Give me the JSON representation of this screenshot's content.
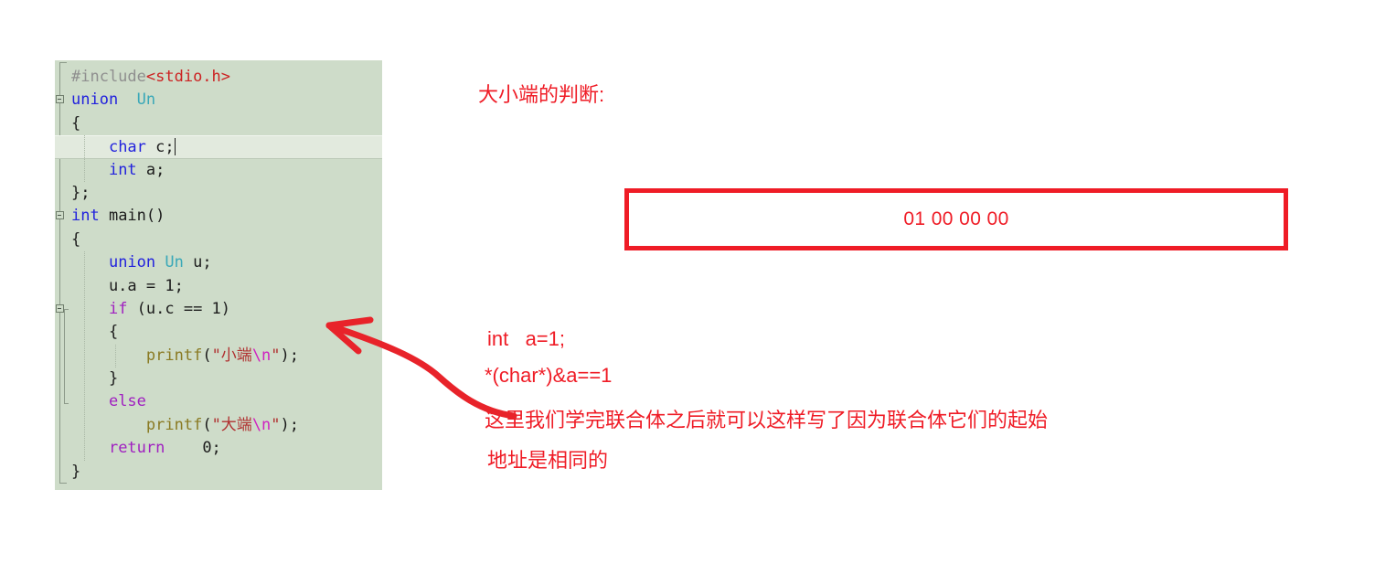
{
  "editor": {
    "name": "c-source-editor",
    "background_color": "#cedcc9",
    "current_line_index": 3,
    "lines": [
      {
        "indent": 1,
        "fold": "none",
        "tokens": [
          {
            "t": "#include",
            "c": "pp"
          },
          {
            "t": "<stdio.h>",
            "c": "header"
          }
        ]
      },
      {
        "indent": 0,
        "fold": "box",
        "tokens": [
          {
            "t": "union",
            "c": "kw"
          },
          {
            "t": "  ",
            "c": "plain"
          },
          {
            "t": "Un",
            "c": "type"
          }
        ]
      },
      {
        "indent": 1,
        "fold": "none",
        "tokens": [
          {
            "t": "{",
            "c": "punct"
          }
        ]
      },
      {
        "indent": 1,
        "fold": "none",
        "current": true,
        "tokens": [
          {
            "t": "    ",
            "c": "plain"
          },
          {
            "t": "char",
            "c": "kw"
          },
          {
            "t": " c",
            "c": "plain"
          },
          {
            "t": ";",
            "c": "punct"
          }
        ]
      },
      {
        "indent": 1,
        "fold": "none",
        "tokens": [
          {
            "t": "    ",
            "c": "plain"
          },
          {
            "t": "int",
            "c": "kw"
          },
          {
            "t": " a",
            "c": "plain"
          },
          {
            "t": ";",
            "c": "punct"
          }
        ]
      },
      {
        "indent": 1,
        "fold": "none",
        "tokens": [
          {
            "t": "};",
            "c": "punct"
          }
        ]
      },
      {
        "indent": 0,
        "fold": "box",
        "tokens": [
          {
            "t": "int",
            "c": "kw"
          },
          {
            "t": " main()",
            "c": "plain"
          }
        ]
      },
      {
        "indent": 1,
        "fold": "none",
        "tokens": [
          {
            "t": "{",
            "c": "punct"
          }
        ]
      },
      {
        "indent": 1,
        "fold": "none",
        "tokens": [
          {
            "t": "    ",
            "c": "plain"
          },
          {
            "t": "union",
            "c": "kw"
          },
          {
            "t": " ",
            "c": "plain"
          },
          {
            "t": "Un",
            "c": "type"
          },
          {
            "t": " u;",
            "c": "plain"
          }
        ]
      },
      {
        "indent": 1,
        "fold": "none",
        "tokens": [
          {
            "t": "    u.a = 1;",
            "c": "plain"
          }
        ]
      },
      {
        "indent": 1,
        "fold": "box",
        "tokens": [
          {
            "t": "    ",
            "c": "plain"
          },
          {
            "t": "if",
            "c": "ctrl"
          },
          {
            "t": " (u.c == 1)",
            "c": "plain"
          }
        ]
      },
      {
        "indent": 1,
        "fold": "none",
        "tokens": [
          {
            "t": "    {",
            "c": "punct"
          }
        ]
      },
      {
        "indent": 1,
        "fold": "none",
        "tokens": [
          {
            "t": "        ",
            "c": "plain"
          },
          {
            "t": "printf",
            "c": "fn"
          },
          {
            "t": "(",
            "c": "punct"
          },
          {
            "t": "\"小端",
            "c": "str"
          },
          {
            "t": "\\n",
            "c": "esc"
          },
          {
            "t": "\"",
            "c": "str"
          },
          {
            "t": ");",
            "c": "punct"
          }
        ]
      },
      {
        "indent": 1,
        "fold": "none",
        "tokens": [
          {
            "t": "    }",
            "c": "punct"
          }
        ]
      },
      {
        "indent": 1,
        "fold": "none",
        "tokens": [
          {
            "t": "    ",
            "c": "plain"
          },
          {
            "t": "else",
            "c": "ctrl"
          }
        ]
      },
      {
        "indent": 1,
        "fold": "none",
        "tokens": [
          {
            "t": "        ",
            "c": "plain"
          },
          {
            "t": "printf",
            "c": "fn"
          },
          {
            "t": "(",
            "c": "punct"
          },
          {
            "t": "\"大端",
            "c": "str"
          },
          {
            "t": "\\n",
            "c": "esc"
          },
          {
            "t": "\"",
            "c": "str"
          },
          {
            "t": ");",
            "c": "punct"
          }
        ]
      },
      {
        "indent": 1,
        "fold": "none",
        "tokens": [
          {
            "t": "    ",
            "c": "plain"
          },
          {
            "t": "return",
            "c": "ctrl"
          },
          {
            "t": "    0;",
            "c": "plain"
          }
        ]
      },
      {
        "indent": 1,
        "fold": "none",
        "tokens": [
          {
            "t": "}",
            "c": "punct"
          }
        ]
      }
    ]
  },
  "annotations": {
    "title": "大小端的判断:",
    "hex_box": {
      "value": "01 00 00 00",
      "border_color": "#ef1c26",
      "text_color": "#ef1c26"
    },
    "code_note_line1": "int   a=1;",
    "code_note_line2": "*(char*)&a==1",
    "chinese_note_line1": "这里我们学完联合体之后就可以这样写了因为联合体它们的起始",
    "chinese_note_line2": "地址是相同的",
    "arrow": {
      "name": "curved-red-arrow",
      "color": "#e8232a"
    }
  }
}
